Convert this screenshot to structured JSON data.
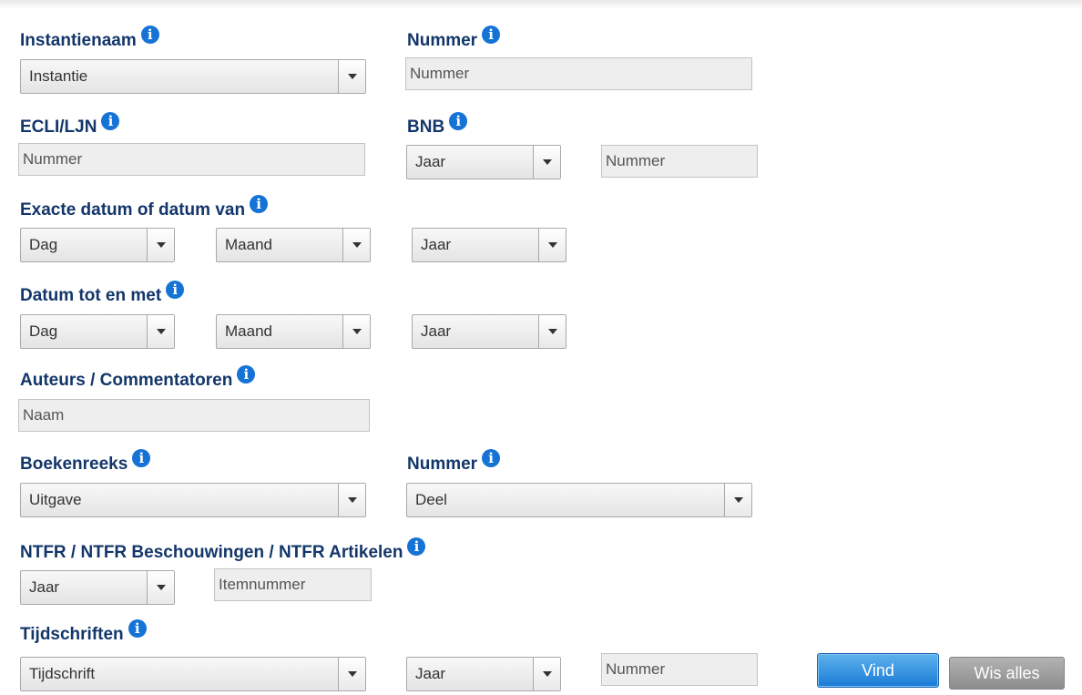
{
  "colors": {
    "label": "#13366a",
    "info_icon": "#1673d6",
    "primary_button": "#1a7bd6",
    "secondary_button": "#8c8c8c"
  },
  "instantienaam": {
    "label": "Instantienaam",
    "select_value": "Instantie"
  },
  "nummer": {
    "label": "Nummer",
    "placeholder": "Nummer"
  },
  "ecli": {
    "label": "ECLI/LJN",
    "placeholder": "Nummer"
  },
  "bnb": {
    "label": "BNB",
    "year_value": "Jaar",
    "placeholder": "Nummer"
  },
  "datum_van": {
    "label": "Exacte datum of datum van",
    "day_value": "Dag",
    "month_value": "Maand",
    "year_value": "Jaar"
  },
  "datum_tot": {
    "label": "Datum tot en met",
    "day_value": "Dag",
    "month_value": "Maand",
    "year_value": "Jaar"
  },
  "auteurs": {
    "label": "Auteurs / Commentatoren",
    "placeholder": "Naam"
  },
  "boekenreeks": {
    "label": "Boekenreeks",
    "select_value": "Uitgave"
  },
  "boek_nummer": {
    "label": "Nummer",
    "select_value": "Deel"
  },
  "ntfr": {
    "label": "NTFR / NTFR Beschouwingen / NTFR Artikelen",
    "year_value": "Jaar",
    "placeholder": "Itemnummer"
  },
  "tijdschriften": {
    "label": "Tijdschriften",
    "select_value": "Tijdschrift",
    "year_value": "Jaar",
    "placeholder": "Nummer"
  },
  "buttons": {
    "vind": "Vind",
    "wis_alles": "Wis alles"
  },
  "icons": {
    "info": "i",
    "dropdown": "chevron-down"
  }
}
